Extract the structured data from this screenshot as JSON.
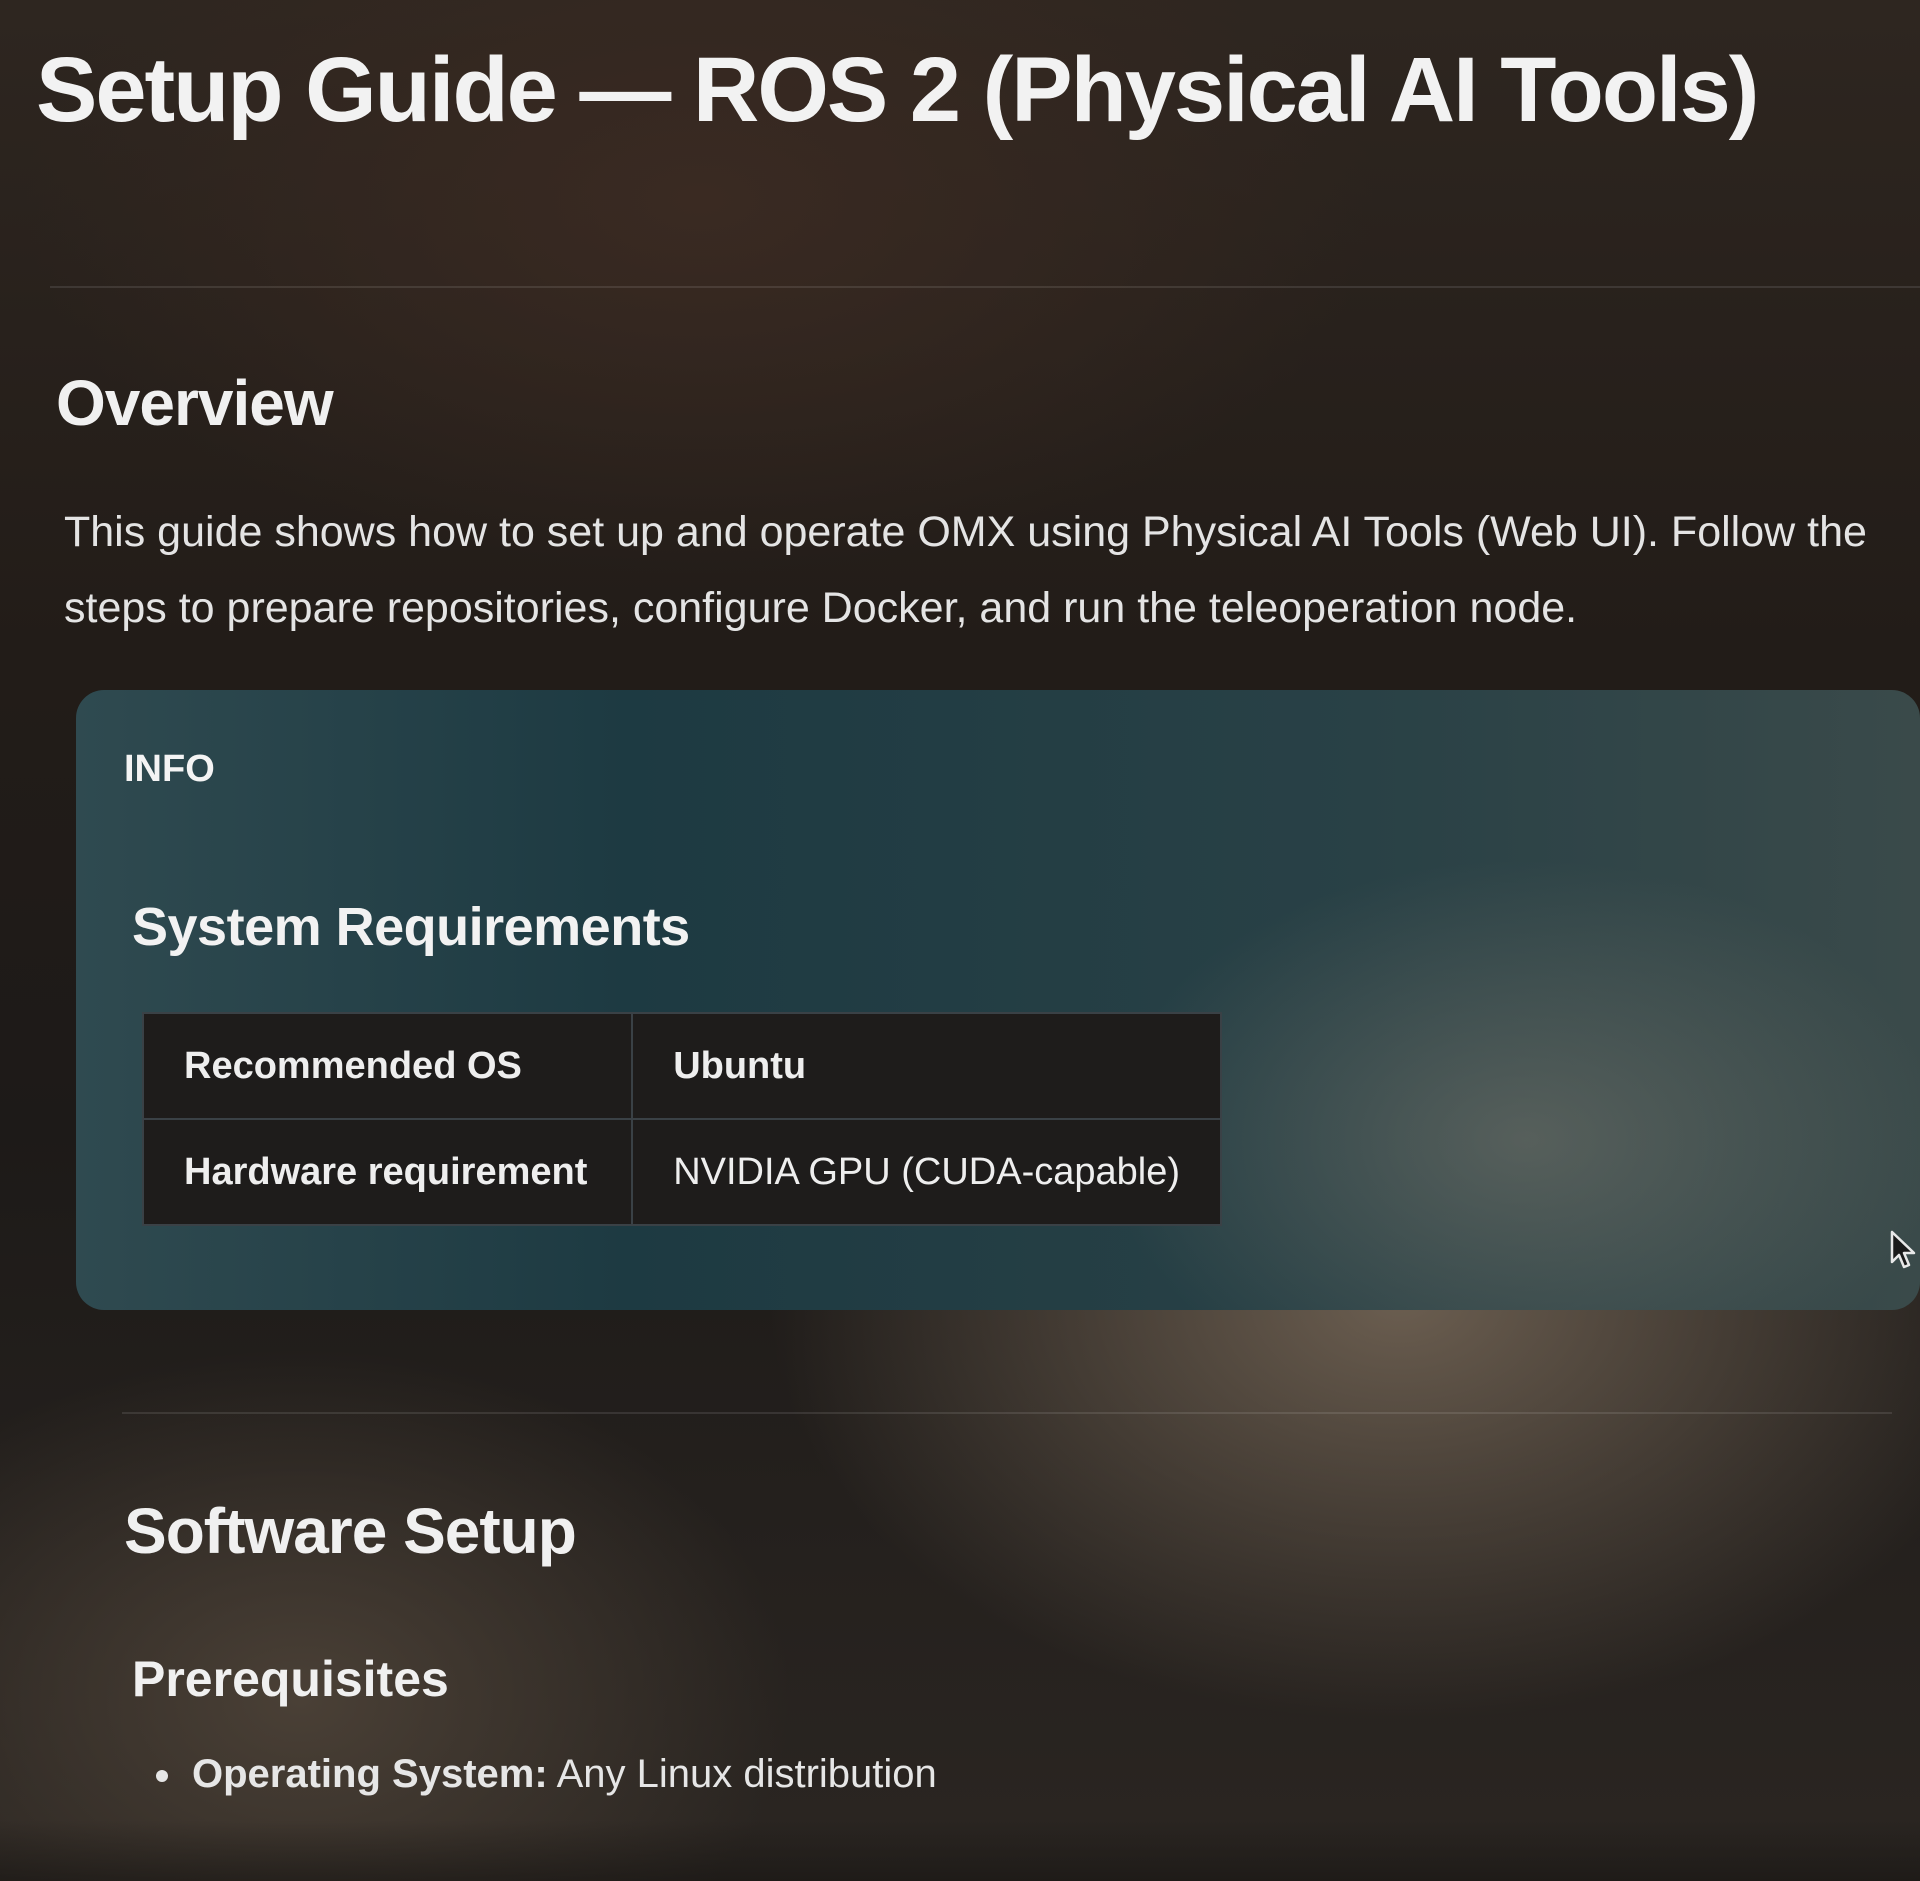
{
  "doc": {
    "title": "Setup Guide — ROS 2 (Physical AI Tools)"
  },
  "overview": {
    "heading": "Overview",
    "text": "This guide shows how to set up and operate OMX using Physical AI Tools (Web UI). Follow the steps to prepare repositories, configure Docker, and run the teleoperation node."
  },
  "info_box": {
    "label": "INFO",
    "heading": "System Requirements",
    "rows": [
      {
        "key": "Recommended OS",
        "value": "Ubuntu"
      },
      {
        "key": "Hardware requirement",
        "value": "NVIDIA GPU (CUDA-capable)"
      }
    ]
  },
  "software_setup": {
    "heading": "Software Setup",
    "prerequisites": {
      "heading": "Prerequisites",
      "items": [
        {
          "label": "Operating System:",
          "value": " Any Linux distribution"
        }
      ]
    }
  },
  "icons": {
    "cursor": "mouse-pointer-icon"
  },
  "colors": {
    "info_box_bg": "#1d3a42",
    "table_bg": "#1e1c1b",
    "text": "#ececec"
  }
}
